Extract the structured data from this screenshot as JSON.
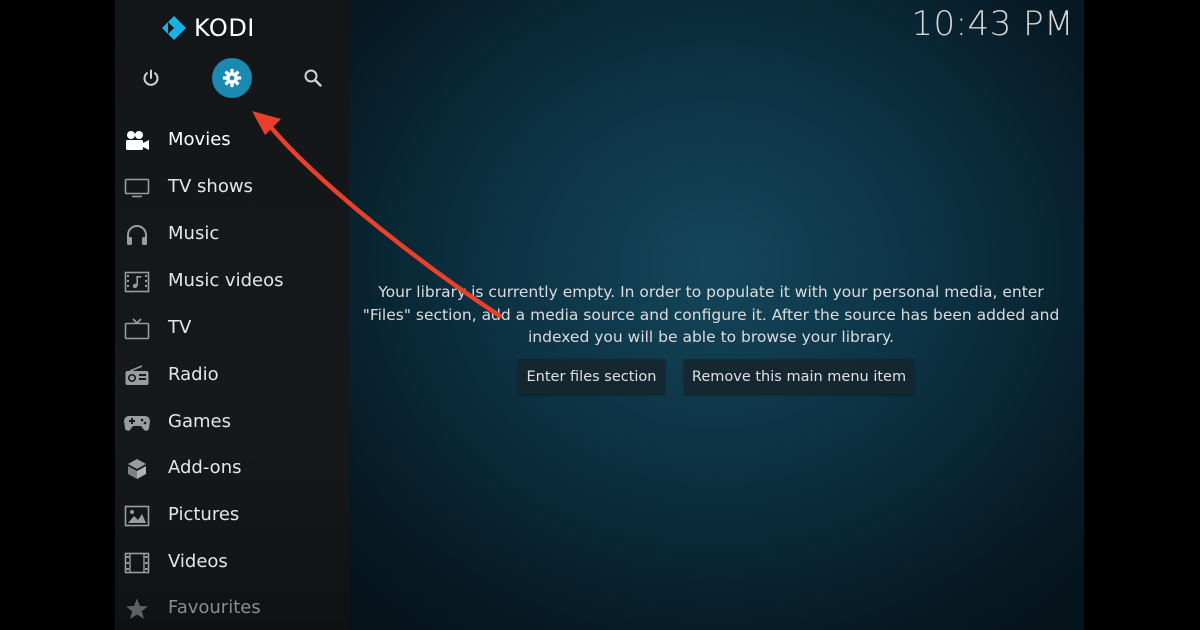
{
  "app": {
    "name": "KODI",
    "clock": "10:43 PM"
  },
  "top_buttons": {
    "power": "power-icon",
    "settings": "gear-icon",
    "search": "search-icon"
  },
  "menu": {
    "items": [
      {
        "label": "Movies",
        "icon": "movie-camera-icon"
      },
      {
        "label": "TV shows",
        "icon": "tv-icon"
      },
      {
        "label": "Music",
        "icon": "headphones-icon"
      },
      {
        "label": "Music videos",
        "icon": "music-video-icon"
      },
      {
        "label": "TV",
        "icon": "tv-antenna-icon"
      },
      {
        "label": "Radio",
        "icon": "radio-icon"
      },
      {
        "label": "Games",
        "icon": "gamepad-icon"
      },
      {
        "label": "Add-ons",
        "icon": "addons-box-icon"
      },
      {
        "label": "Pictures",
        "icon": "picture-icon"
      },
      {
        "label": "Videos",
        "icon": "film-strip-icon"
      },
      {
        "label": "Favourites",
        "icon": "star-icon"
      }
    ]
  },
  "main": {
    "empty_message": "Your library is currently empty. In order to populate it with your personal media, enter \"Files\" section, add a media source and configure it. After the source has been added and indexed you will be able to browse your library.",
    "enter_files_label": "Enter files section",
    "remove_item_label": "Remove this main menu item"
  },
  "colors": {
    "accent": "#1b8ab0",
    "annotation_arrow": "#e8402a"
  }
}
